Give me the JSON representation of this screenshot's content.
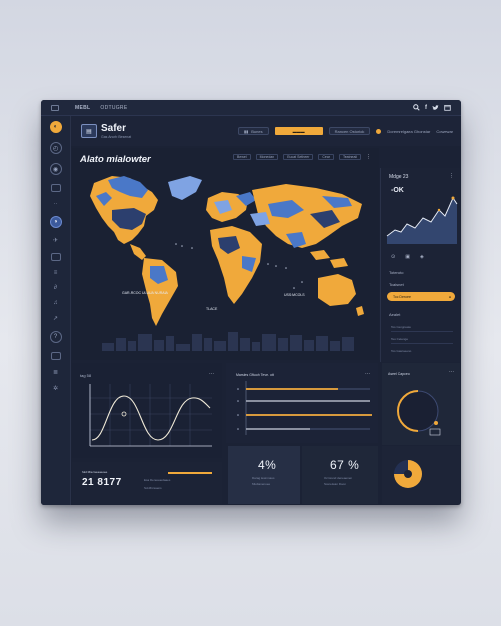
{
  "topbar": {
    "nav_primary": "MEBL",
    "nav_secondary": "ODTUGRE",
    "icons": [
      "search-icon",
      "facebook-icon",
      "twitter-icon",
      "calendar-icon"
    ]
  },
  "header": {
    "title": "Safer",
    "subtitle": "Gas Ancrb Besenat",
    "pill_label": "Bunes",
    "filter_label": "Rancen Ostoriok",
    "right_label": "Doremrelgaea Ghonstar",
    "right_label2": "Cowewar"
  },
  "map_panel": {
    "title": "Alato mialowter",
    "tools": [
      "Bewel",
      "Monedan",
      "Eucat Setheer",
      "Cear",
      "Teatneali"
    ],
    "annotation1": "GAR-RCOC ULUUA  NURAIA",
    "annotation2": "TLACE",
    "annotation3": "USS:MCOLS"
  },
  "right_panel": {
    "title": "Mdge 23",
    "big": "-OK",
    "row1": "Toteroto",
    "row2": "Tcaisnet",
    "button": "Toc Deroee",
    "section": "Aealet",
    "item1": "Tos Cengnuaw",
    "item2": "Teu Cetenge",
    "item3": "Tos Gasroeeno"
  },
  "wave_panel": {
    "title": "tag 58"
  },
  "bars_panel": {
    "title": "Marsles Gftuoh Teve. ott"
  },
  "gauge_panel": {
    "title": "Aseel Capceo"
  },
  "footer_panel": {
    "label": "fold Mia Geaueoee",
    "big": "21 8177",
    "line1": "Esa Deneauedaaes",
    "line2": "Sd-Mrcsaens"
  },
  "stats": [
    {
      "value": "4%",
      "line1": "Darag lewmnaus",
      "line2": "Mtoltanenuee"
    },
    {
      "value": "67 %",
      "line1": "Ocmrend deneaenen",
      "line2": "Scereiwan Doon"
    }
  ],
  "colors": {
    "accent": "#f0a93b",
    "blue": "#4a78c8",
    "light_blue": "#7fa3e3",
    "panel": "#1a2133"
  }
}
